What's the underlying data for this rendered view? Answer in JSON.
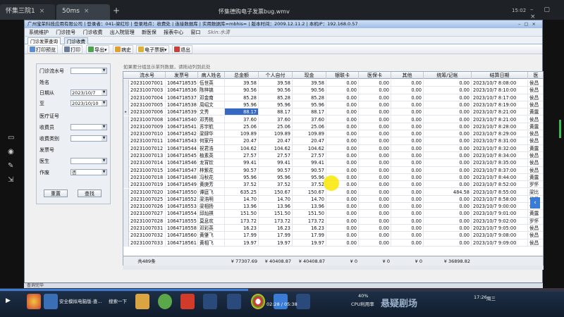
{
  "outer_tabs": [
    {
      "label": "怀集三院1"
    },
    {
      "label": "50ms"
    }
  ],
  "video_title": "怀集德购电子发票bug.wmv",
  "clock": "15:02",
  "app": {
    "title": "广州宝荣科技应用有限公司 | 登录者：041-梁红珍 | 登录地点：收费处 | 连接数据库 | 实用数据库=mbhis= | 版本时间：2009.12.11.2 | 本机IP：192.168.0.57",
    "menu": [
      "系统维护",
      "门诊挂号",
      "门诊收费",
      "出入院管理",
      "新医保",
      "报表中心",
      "窗口",
      "Skin:水清"
    ],
    "tabs": [
      "门诊发票查询",
      "门诊收费"
    ],
    "toolbar": [
      "打印预览",
      "打印",
      "导出",
      "病史",
      "电子票据",
      "退出"
    ]
  },
  "query": {
    "labels": [
      "门诊流水号",
      "姓名",
      "日期从",
      "至",
      "医疗证号",
      "收费员",
      "收费类别",
      "发票号",
      "医生",
      "作废"
    ],
    "date_from": "2023/10/7",
    "date_to": "2023/10/10",
    "void_value": "否",
    "reset_button": "重置",
    "search_button": "查找"
  },
  "hint": "如果要分组显示某列数据，请拖动列到此处",
  "table": {
    "columns": [
      "流水号",
      "发票号",
      "病人姓名",
      "总金额",
      "个人自付",
      "现金",
      "银联卡",
      "医保卡",
      "其他",
      "统筹/记帐",
      "结算日期",
      "医"
    ],
    "rows": [
      [
        "20231007001",
        "1064718535",
        "伍世英",
        "39.58",
        "39.58",
        "39.58",
        "0.00",
        "0.00",
        "0.00",
        "0.00",
        "2023/10/7 8:08:00",
        "侯昌"
      ],
      [
        "20231007003",
        "1064718536",
        "陈梓镐",
        "90.56",
        "90.56",
        "90.56",
        "0.00",
        "0.00",
        "0.00",
        "0.00",
        "2023/10/7 8:10:00",
        "侯昌"
      ],
      [
        "20231007004",
        "1064718537",
        "邓金南",
        "85.28",
        "85.28",
        "85.28",
        "0.00",
        "0.00",
        "0.00",
        "0.00",
        "2023/10/7 8:17:00",
        "侯昌"
      ],
      [
        "20231007005",
        "1064718538",
        "周绍文",
        "95.96",
        "95.96",
        "95.96",
        "0.00",
        "0.00",
        "0.00",
        "0.00",
        "2023/10/7 8:19:00",
        "侯昌"
      ],
      [
        "20231007006",
        "1064718539",
        "文秀",
        "88.17",
        "88.17",
        "88.17",
        "0.00",
        "0.00",
        "0.00",
        "0.00",
        "2023/10/7 8:21:00",
        "黄露"
      ],
      [
        "20231007008",
        "1064718540",
        "邓秀桃",
        "37.60",
        "37.60",
        "37.60",
        "0.00",
        "0.00",
        "0.00",
        "0.00",
        "2023/10/7 8:21:00",
        "侯昌"
      ],
      [
        "20231007009",
        "1064718541",
        "苏宇航",
        "25.06",
        "25.06",
        "25.06",
        "0.00",
        "0.00",
        "0.00",
        "0.00",
        "2023/10/7 8:28:00",
        "黄露"
      ],
      [
        "20231007010",
        "1064718542",
        "梁肆华",
        "109.89",
        "109.89",
        "109.89",
        "0.00",
        "0.00",
        "0.00",
        "0.00",
        "2023/10/7 8:29:00",
        "侯昌"
      ],
      [
        "20231007011",
        "1064718543",
        "何家丹",
        "20.47",
        "20.47",
        "20.47",
        "0.00",
        "0.00",
        "0.00",
        "0.00",
        "2023/10/7 8:31:00",
        "侯昌"
      ],
      [
        "20231007012",
        "1064718544",
        "祝君浩",
        "104.62",
        "104.62",
        "104.62",
        "0.00",
        "0.00",
        "0.00",
        "0.00",
        "2023/10/7 8:32:00",
        "黄露"
      ],
      [
        "20231007013",
        "1064718545",
        "植素英",
        "27.57",
        "27.57",
        "27.57",
        "0.00",
        "0.00",
        "0.00",
        "0.00",
        "2023/10/7 8:34:00",
        "侯昌"
      ],
      [
        "20231007014",
        "1064718546",
        "龙宵钦",
        "99.41",
        "99.41",
        "99.41",
        "0.00",
        "0.00",
        "0.00",
        "0.00",
        "2023/10/7 8:35:00",
        "侯昌"
      ],
      [
        "20231007015",
        "1064718547",
        "林紫花",
        "90.57",
        "90.57",
        "90.57",
        "0.00",
        "0.00",
        "0.00",
        "0.00",
        "2023/10/7 8:37:00",
        "侯昌"
      ],
      [
        "20231007018",
        "1064718548",
        "冯秋花",
        "95.96",
        "95.96",
        "95.96",
        "0.00",
        "0.00",
        "0.00",
        "0.00",
        "2023/10/7 8:44:00",
        "黄露"
      ],
      [
        "20231007019",
        "1064718549",
        "黄庚芳",
        "37.52",
        "37.52",
        "37.52",
        "0.00",
        "0.00",
        "0.00",
        "0.00",
        "2023/10/7 8:52:00",
        "罗怀"
      ],
      [
        "20231007020",
        "1064718550",
        "谭庭飞",
        "635.25",
        "150.67",
        "150.67",
        "0.00",
        "0.00",
        "0.00",
        "484.58",
        "2023/10/7 8:55:00",
        "梁比"
      ],
      [
        "20231007025",
        "1064718552",
        "梁浩明",
        "14.70",
        "14.70",
        "14.70",
        "0.00",
        "0.00",
        "0.00",
        "0.00",
        "2023/10/7 8:58:00",
        "侯昌"
      ],
      [
        "20231007026",
        "1064718553",
        "梁相扬",
        "13.96",
        "13.96",
        "13.96",
        "0.00",
        "0.00",
        "0.00",
        "0.00",
        "2023/10/7 9:00:00",
        "侯昌"
      ],
      [
        "20231007027",
        "1064718554",
        "邱灿祺",
        "151.50",
        "151.50",
        "151.50",
        "0.00",
        "0.00",
        "0.00",
        "0.00",
        "2023/10/7 9:01:00",
        "黄露"
      ],
      [
        "20231007028",
        "1064718555",
        "莫息欢",
        "173.72",
        "173.72",
        "173.72",
        "0.00",
        "0.00",
        "0.00",
        "0.00",
        "2023/10/7 9:02:00",
        "罗怀"
      ],
      [
        "20231007031",
        "1064718558",
        "邓彩英",
        "16.23",
        "16.23",
        "16.23",
        "0.00",
        "0.00",
        "0.00",
        "0.00",
        "2023/10/7 9:05:00",
        "侯昌"
      ],
      [
        "20231007032",
        "1064718560",
        "黄肇飞",
        "17.99",
        "17.99",
        "17.99",
        "0.00",
        "0.00",
        "0.00",
        "0.00",
        "2023/10/7 9:08:00",
        "侯昌"
      ],
      [
        "20231007033",
        "1064718561",
        "黄相飞",
        "19.97",
        "19.97",
        "19.97",
        "0.00",
        "0.00",
        "0.00",
        "0.00",
        "2023/10/7 9:09:00",
        "侯昌"
      ]
    ],
    "selected_row": 4,
    "footer": {
      "count": "共489条",
      "total": "¥ 77307.69",
      "self_pay": "¥ 40408.87",
      "cash": "¥ 40408.87",
      "unionpay": "¥ 0",
      "medicare": "¥ 0",
      "other": "¥ 0",
      "overall": "¥ 36898.82"
    }
  },
  "status": "查询完毕",
  "video_progress": 0.44,
  "taskbar": {
    "items": [
      "安全模拟电脑版-查...",
      "搜索一下"
    ],
    "video_time": "02:28 / 05:38",
    "cpu": "CPU利用率",
    "cpu_value": "40%",
    "watermark": "悬疑剧场",
    "tray_time": "17:26",
    "tray_day": "周三"
  }
}
